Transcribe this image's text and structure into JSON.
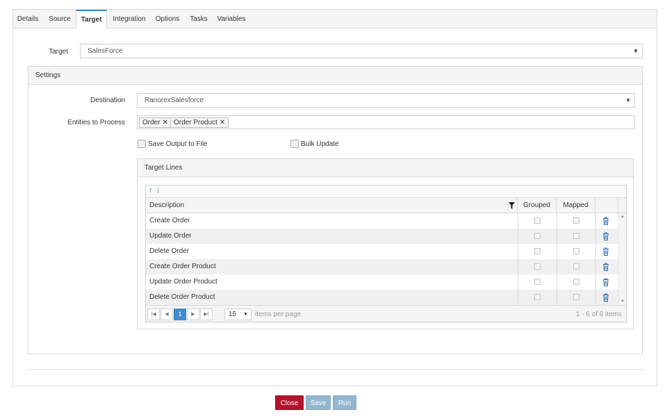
{
  "tabs": [
    {
      "label": "Details",
      "active": false
    },
    {
      "label": "Source",
      "active": false
    },
    {
      "label": "Target",
      "active": true
    },
    {
      "label": "Integration",
      "active": false
    },
    {
      "label": "Options",
      "active": false
    },
    {
      "label": "Tasks",
      "active": false
    },
    {
      "label": "Variables",
      "active": false
    }
  ],
  "target": {
    "label": "Target",
    "value": "SalesForce"
  },
  "settings": {
    "title": "Settings",
    "destination": {
      "label": "Destination",
      "value": "RanorexSalesforce"
    },
    "entities": {
      "label": "Entities to Process",
      "tags": [
        "Order",
        "Order Product"
      ]
    },
    "save_output": {
      "label": "Save Output to File",
      "checked": false
    },
    "bulk_update": {
      "label": "Bulk Update",
      "checked": false
    }
  },
  "target_lines": {
    "title": "Target Lines",
    "columns": [
      "Description",
      "Grouped",
      "Mapped"
    ],
    "rows": [
      {
        "description": "Create Order",
        "grouped": false,
        "mapped": false
      },
      {
        "description": "Update Order",
        "grouped": false,
        "mapped": false
      },
      {
        "description": "Delete Order",
        "grouped": false,
        "mapped": false
      },
      {
        "description": "Create Order Product",
        "grouped": false,
        "mapped": false
      },
      {
        "description": "Update Order Product",
        "grouped": false,
        "mapped": false
      },
      {
        "description": "Delete Order Product",
        "grouped": false,
        "mapped": false
      }
    ],
    "pager": {
      "current_page": "1",
      "page_size": "15",
      "items_per_page_label": "items per page",
      "summary": "1 - 6 of 6 items"
    }
  },
  "footer": {
    "close_label": "Close",
    "save_label": "Save",
    "run_label": "Run"
  },
  "colors": {
    "accent": "#428bca",
    "close_button": "#b3122d",
    "disabled_button": "#94b7cf"
  }
}
